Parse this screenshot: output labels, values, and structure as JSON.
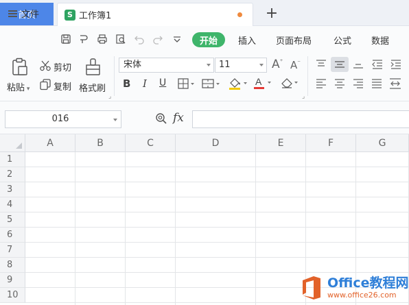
{
  "tabs": {
    "home": "首页",
    "document": "工作簿1",
    "doc_icon_letter": "S",
    "new_tab": "+"
  },
  "menubar": {
    "file": "文件",
    "items": [
      "开始",
      "插入",
      "页面布局",
      "公式",
      "数据"
    ],
    "active": "开始"
  },
  "ribbon": {
    "paste": "粘贴",
    "cut": "剪切",
    "copy": "复制",
    "format_painter": "格式刷",
    "font_name": "宋体",
    "font_size": "11",
    "bold": "B",
    "italic": "I",
    "underline": "U",
    "increase_font": "A⁺",
    "decrease_font": "A⁻",
    "font_color_letter": "A"
  },
  "formula_bar": {
    "name_box": "016",
    "fx": "fx",
    "formula": ""
  },
  "grid": {
    "columns": [
      "A",
      "B",
      "C",
      "D",
      "E",
      "F",
      "G"
    ],
    "rows": [
      "1",
      "2",
      "3",
      "4",
      "5",
      "6",
      "7",
      "8",
      "9",
      "10"
    ]
  },
  "watermark": {
    "brand": "Office教程网",
    "url": "www.office26.com"
  },
  "colors": {
    "home_tab": "#4d86e8",
    "active_menu": "#3fb56b",
    "doc_icon": "#2ea361",
    "unsaved_dot": "#ef8a3e",
    "watermark_orange": "#e2622a",
    "watermark_blue": "#2f7fd8"
  }
}
